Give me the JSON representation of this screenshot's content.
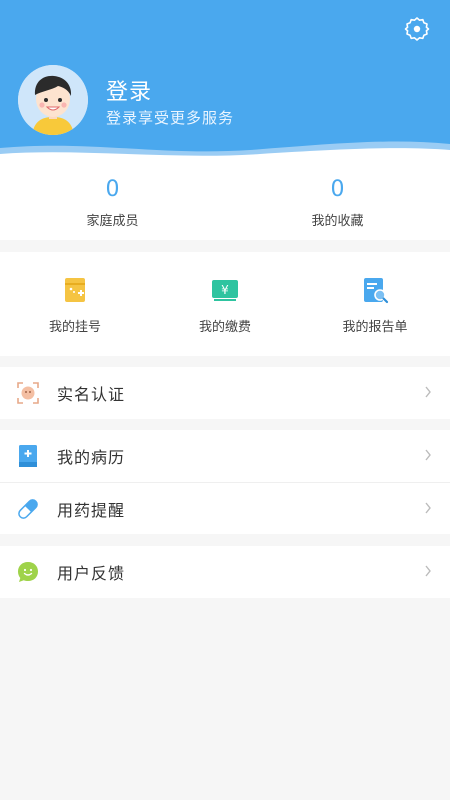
{
  "header": {
    "title": "登录",
    "subtitle": "登录享受更多服务",
    "settings_icon": "gear-icon",
    "bg_color": "#4aa8ee"
  },
  "stats": [
    {
      "value": "0",
      "label": "家庭成员"
    },
    {
      "value": "0",
      "label": "我的收藏"
    }
  ],
  "quick_actions": [
    {
      "label": "我的挂号",
      "icon": "registration-icon",
      "color": "#f5c443"
    },
    {
      "label": "我的缴费",
      "icon": "payment-icon",
      "color": "#2ec4a0"
    },
    {
      "label": "我的报告单",
      "icon": "report-icon",
      "color": "#4aa8ee"
    }
  ],
  "menu": [
    {
      "label": "实名认证",
      "icon": "id-verify-icon"
    },
    {
      "label": "我的病历",
      "icon": "medical-record-icon"
    },
    {
      "label": "用药提醒",
      "icon": "pill-icon"
    },
    {
      "label": "用户反馈",
      "icon": "feedback-icon"
    }
  ],
  "accent_color": "#4aa8ee"
}
